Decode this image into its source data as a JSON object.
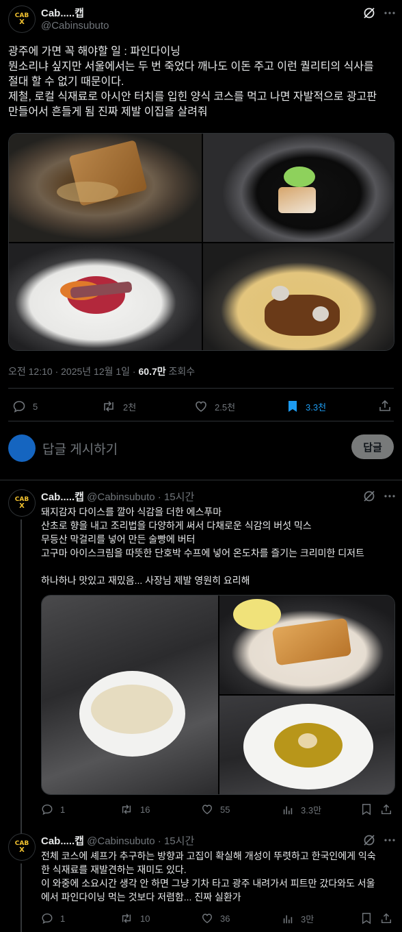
{
  "main": {
    "author_name": "Cab.....캡",
    "handle": "@Cabinsubuto",
    "avatar_text": [
      "CAB",
      "X"
    ],
    "text": "광주에 가면 꼭 해야할 일 : 파인다이닝\n뭔소리냐 싶지만 서울에서는 두 번 죽었다 깨나도 이돈 주고 이런 퀄리티의 식사를\n절대 할 수 없기 때문이다.\n제철, 로컬 식재료로 아시안 터치를 입힌 양식 코스를 먹고 나면 자발적으로 광고판\n만들어서 흔들게 됨 진짜 제발 이집을 살려줘",
    "timestamp": "오전 12:10 · 2025년 12월 1일 ·",
    "views": "60.7만",
    "views_label": "조회수",
    "stats": {
      "replies": "5",
      "reposts": "2천",
      "likes": "2.5천",
      "bookmarks": "3.3천"
    }
  },
  "compose": {
    "placeholder": "답글 게시하기",
    "button": "답글"
  },
  "reply1": {
    "author_name": "Cab.....캡",
    "handle": "@Cabinsubuto",
    "time": "· 15시간",
    "text": "돼지감자 다이스를 깔아 식감을 더한 에스푸마\n산초로 향을 내고 조리법을 다양하게 써서 다채로운 식감의 버섯 믹스\n무등산 막걸리를 넣어 만든 술빵에 버터\n고구마 아이스크림을 따뜻한 단호박 수프에 넣어 온도차를 즐기는 크리미한 디저트\n\n하나하나 맛있고 재밌음... 사장님 제발 영원히 요리해",
    "stats": {
      "replies": "1",
      "reposts": "16",
      "likes": "55",
      "views": "3.3만"
    }
  },
  "reply2": {
    "author_name": "Cab.....캡",
    "handle": "@Cabinsubuto",
    "time": "· 15시간",
    "text": "전체 코스에 셰프가 추구하는 방향과 고집이 확실해 개성이 뚜렷하고 한국인에게 익숙\n한 식재료를 재발견하는 재미도 있다.\n이 와중에 소요시간 생각 안 하면 그냥 기차 타고 광주 내려가서 피트만 갔다와도 서울\n에서 파인다이닝 먹는 것보다 저렴함... 진짜 실환가",
    "stats": {
      "replies": "1",
      "reposts": "10",
      "likes": "36",
      "views": "3만"
    }
  },
  "colors": {
    "accent": "#1d9bf0",
    "bookmark": "#1d9bf0",
    "gold": "#f2c230"
  }
}
